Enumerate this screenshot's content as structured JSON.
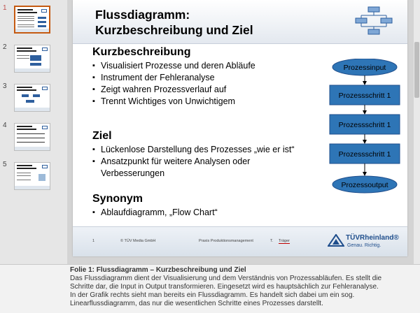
{
  "thumbnails": [
    {
      "number": "1",
      "active": true
    },
    {
      "number": "2",
      "active": false
    },
    {
      "number": "3",
      "active": false
    },
    {
      "number": "4",
      "active": false
    },
    {
      "number": "5",
      "active": false
    }
  ],
  "slide": {
    "title_line1": "Flussdiagramm:",
    "title_line2": "Kurzbeschreibung und Ziel",
    "sections": [
      {
        "heading": "Kurzbeschreibung",
        "bullets": [
          "Visualisiert Prozesse und deren Abläufe",
          "Instrument der Fehleranalyse",
          "Zeigt wahren Prozessverlauf auf",
          "Trennt Wichtiges von Unwichtigem"
        ]
      },
      {
        "heading": "Ziel",
        "bullets": [
          "Lückenlose Darstellung des Prozesses „wie er ist“",
          "Ansatzpunkt für weitere Analysen oder Verbesserungen"
        ]
      },
      {
        "heading": "Synonym",
        "bullets": [
          "Ablaufdiagramm, „Flow Chart“"
        ]
      }
    ],
    "flowchart": {
      "start": "Prozessinput",
      "steps": [
        "Prozessschritt 1",
        "Prozessschritt 1",
        "Prozessschritt 1"
      ],
      "end": "Prozessoutput",
      "fill_color": "#2e75b6",
      "text_color": "#000000"
    },
    "footer": {
      "page": "1",
      "copyright": "© TÜV Media GmbH",
      "course": "Praxis Produktionsmanagement",
      "author_prefix": "T.",
      "author": "Träger",
      "brand": "TÜVRheinland®",
      "slogan": "Genau. Richtig."
    }
  },
  "notes": {
    "title": "Folie 1: Flussdiagramm – Kurzbeschreibung und Ziel",
    "lines": [
      "Das Flussdiagramm dient der Visualisierung und dem Verständnis von Prozessabläufen. Es stellt die",
      "Schritte dar, die Input in Output transformieren. Eingesetzt wird es hauptsächlich zur Fehleranalyse.",
      "In der Grafik rechts sieht man bereits ein Flussdiagramm. Es handelt sich dabei um ein sog.",
      "Linearflussdiagramm, das nur die wesentlichen Schritte eines Prozesses darstellt."
    ]
  },
  "colors": {
    "accent": "#c55a11",
    "brand": "#1f4e8c",
    "shape": "#2e75b6"
  }
}
